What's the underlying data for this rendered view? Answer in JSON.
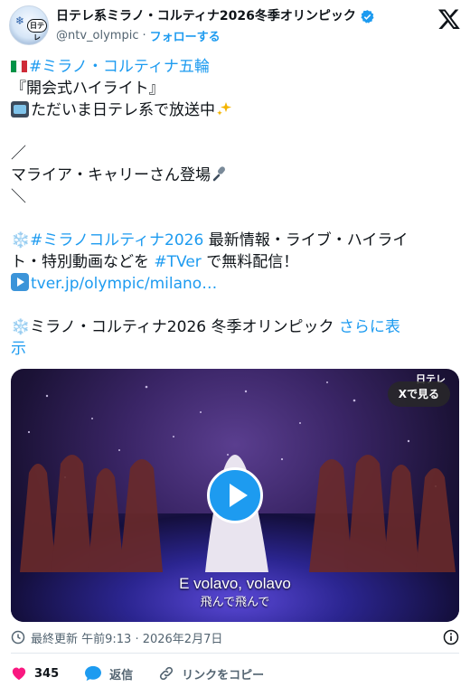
{
  "header": {
    "avatar_mark": "日テレ",
    "name": "日テレ系ミラノ・コルティナ2026冬季オリンピック",
    "handle": "@ntv_olympic",
    "separator": "·",
    "follow_label": "フォローする"
  },
  "tweet": {
    "line1_hashtag": "#ミラノ・コルティナ五輪",
    "line2": "『開会式ハイライト』",
    "line3": "ただいま日テレ系で放送中",
    "line5": "／",
    "line6": "マライア・キャリーさん登場",
    "line7": "＼",
    "line9_hashtag": "#ミラノコルティナ2026",
    "line9_rest": " 最新情報・ライブ・ハイライ",
    "line10_a": "ト・特別動画などを ",
    "line10_hashtag": "#TVer",
    "line10_b": " で無料配信！",
    "line11_link": "tver.jp/olympic/milano…",
    "line13_text": "ミラノ・コルティナ2026 冬季オリンピック ",
    "line13_more_a": "さらに表",
    "line14_more_b": "示"
  },
  "media": {
    "watch_on_x": "Xで見る",
    "channel_logo": "日テレ",
    "subtitle_en": "E volavo, volavo",
    "subtitle_ja": "飛んで飛んで"
  },
  "meta": {
    "last_updated": "最終更新 午前9:13 · 2026年2月7日"
  },
  "actions": {
    "likes": "345",
    "reply_label": "返信",
    "copy_link_label": "リンクをコピー"
  },
  "colors": {
    "accent": "#1d9bf0",
    "like": "#f91880",
    "text": "#0f1419",
    "secondary": "#536471"
  },
  "icons": [
    "verified-badge-icon",
    "x-logo-icon",
    "italy-flag-icon",
    "tv-icon",
    "sparkle-icon",
    "microphone-icon",
    "snowflake-icon",
    "play-button-icon",
    "clock-icon",
    "info-icon",
    "heart-icon",
    "reply-icon",
    "link-icon"
  ]
}
